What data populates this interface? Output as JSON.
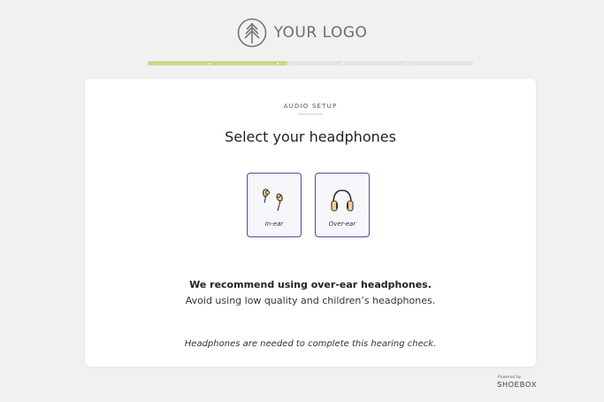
{
  "header": {
    "logo_text": "YOUR LOGO"
  },
  "progress": {
    "filled_fraction": 0.43,
    "steps": 5
  },
  "card": {
    "step_label": "AUDIO SETUP",
    "title": "Select your headphones",
    "options": [
      {
        "label": "In-ear",
        "icon": "in-ear-headphones-icon"
      },
      {
        "label": "Over-ear",
        "icon": "over-ear-headphones-icon"
      }
    ],
    "recommendation": "We recommend using over-ear headphones.",
    "avoid_text": "Avoid using low quality and children’s headphones.",
    "note": "Headphones are needed to complete this hearing check."
  },
  "footer": {
    "powered_by": "Powered by",
    "brand": "SHOEBOX"
  },
  "colors": {
    "background": "#f1f1f1",
    "progress_fill": "#c9d98a",
    "option_border": "#4a4f9e",
    "icon_fill": "#f4d08a"
  }
}
